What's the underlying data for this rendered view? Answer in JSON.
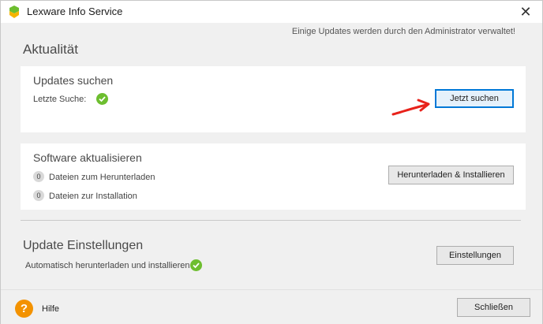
{
  "window": {
    "title": "Lexware Info Service",
    "close_glyph": "✕"
  },
  "header": {
    "admin_note": "Einige Updates werden durch den Administrator verwaltet!",
    "section_title": "Aktualität"
  },
  "updates_search": {
    "title": "Updates suchen",
    "last_search_label": "Letzte Suche:",
    "button_label": "Jetzt suchen"
  },
  "software_update": {
    "title": "Software aktualisieren",
    "download_count": "0",
    "download_label": "Dateien zum Herunterladen",
    "install_count": "0",
    "install_label": "Dateien zur Installation",
    "button_label": "Herunterladen & Installieren"
  },
  "update_settings": {
    "title": "Update Einstellungen",
    "auto_label": "Automatisch herunterladen und installieren",
    "button_label": "Einstellungen"
  },
  "footer": {
    "help_glyph": "?",
    "help_label": "Hilfe",
    "close_button_label": "Schließen"
  },
  "colors": {
    "check_green": "#6dbe2f",
    "help_orange": "#f39200",
    "primary_border": "#0078d7",
    "arrow_red": "#e8221b"
  },
  "icons": [
    "app-icon",
    "close-icon",
    "checkmark-icon",
    "help-icon",
    "arrow-annotation-icon"
  ]
}
